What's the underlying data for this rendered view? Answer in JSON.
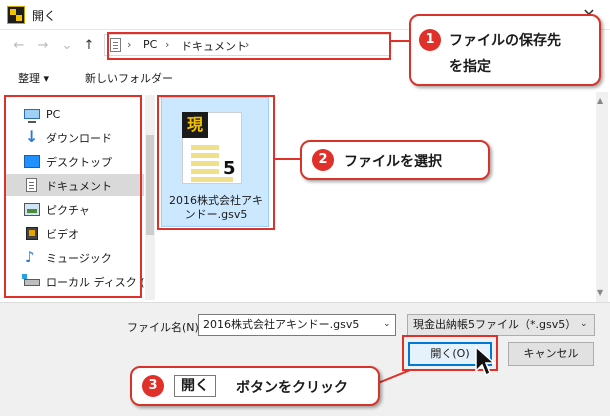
{
  "window": {
    "title": "開く",
    "close_glyph": "✕"
  },
  "address_bar": {
    "back": "←",
    "forward": "→",
    "recent": "⌄",
    "up": "↑",
    "separator": "›",
    "crumbs": [
      "PC",
      "ドキュメント"
    ],
    "dropdown": "⌄",
    "refresh": "↻"
  },
  "toolbar": {
    "organize": "整理 ▾",
    "new_folder": "新しいフォルダー"
  },
  "nav_pane": {
    "items": [
      {
        "label": "PC",
        "icon": "pc-icon"
      },
      {
        "label": "ダウンロード",
        "icon": "download-icon"
      },
      {
        "label": "デスクトップ",
        "icon": "desktop-icon"
      },
      {
        "label": "ドキュメント",
        "icon": "documents-icon",
        "selected": true
      },
      {
        "label": "ピクチャ",
        "icon": "pictures-icon"
      },
      {
        "label": "ビデオ",
        "icon": "videos-icon"
      },
      {
        "label": "ミュージック",
        "icon": "music-icon"
      },
      {
        "label": "ローカル ディスク (C",
        "icon": "local-disk-icon"
      }
    ]
  },
  "files": [
    {
      "name_line1": "2016株式会社アキ",
      "name_line2": "ンドー.gsv5",
      "badge": "現",
      "number": "5"
    }
  ],
  "bottom": {
    "filename_label": "ファイル名(N):",
    "filename_value": "2016株式会社アキンドー.gsv5",
    "filter_value": "現金出納帳5ファイル（*.gsv5）",
    "open_label": "開く(O)",
    "cancel_label": "キャンセル",
    "arrow": "⌄"
  },
  "callouts": {
    "c1": {
      "num": "1",
      "line1": "ファイルの保存先",
      "line2": "を指定"
    },
    "c2": {
      "num": "2",
      "text": "ファイルを選択"
    },
    "c3": {
      "num": "3",
      "chip": "開く",
      "text": "ボタンをクリック"
    }
  },
  "colors": {
    "accent_red": "#e0302a",
    "selection_blue": "#cce8ff",
    "default_button": "#0078d7"
  }
}
